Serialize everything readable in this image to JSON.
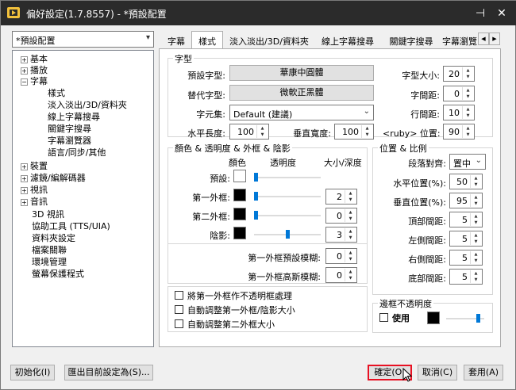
{
  "window": {
    "title": "偏好設定(1.7.8557) - *預設配置",
    "pin_glyph": "⊣",
    "close_glyph": "✕"
  },
  "profile": {
    "selected": "*預設配置"
  },
  "tree": {
    "items": [
      {
        "label": "基本",
        "exp": "+"
      },
      {
        "label": "播放",
        "exp": "+"
      },
      {
        "label": "字幕",
        "exp": "−"
      },
      {
        "label": "樣式"
      },
      {
        "label": "淡入淡出/3D/資料夾"
      },
      {
        "label": "線上字幕搜尋"
      },
      {
        "label": "關鍵字搜尋"
      },
      {
        "label": "字幕瀏覽器"
      },
      {
        "label": "語言/同步/其他"
      },
      {
        "label": "裝置",
        "exp": "+"
      },
      {
        "label": "濾鏡/編解碼器",
        "exp": "+"
      },
      {
        "label": "視訊",
        "exp": "+"
      },
      {
        "label": "音訊",
        "exp": "+"
      },
      {
        "label": "3D 視訊"
      },
      {
        "label": "協助工具 (TTS/UIA)"
      },
      {
        "label": "資料夾設定"
      },
      {
        "label": "檔案關聯"
      },
      {
        "label": "環境管理"
      },
      {
        "label": "螢幕保護程式"
      }
    ]
  },
  "tabs": [
    "字幕",
    "樣式",
    "淡入淡出/3D/資料夾",
    "線上字幕搜尋",
    "關鍵字搜尋",
    "字幕瀏覽"
  ],
  "font_group": {
    "title": "字型",
    "primary_label": "預設字型:",
    "primary_value": "華康中圓體",
    "alt_label": "替代字型:",
    "alt_value": "微軟正黑體",
    "charset_label": "字元集:",
    "charset_value": "Default (建議)",
    "hscale_label": "水平長度:",
    "hscale_value": "100",
    "vscale_label": "垂直寬度:",
    "vscale_value": "100",
    "size_label": "字型大小:",
    "size_value": "20",
    "spacing_label": "字間距:",
    "spacing_value": "0",
    "linespacing_label": "行間距:",
    "linespacing_value": "10",
    "ruby_label": "<ruby> 位置:",
    "ruby_value": "90"
  },
  "color_group": {
    "title": "顏色 & 透明度 & 外框 & 陰影",
    "col_color": "顏色",
    "col_opacity": "透明度",
    "col_size": "大小/深度",
    "rows": [
      {
        "label": "預設:",
        "color": "#ffffff",
        "opacity": 0,
        "size": null
      },
      {
        "label": "第一外框:",
        "color": "#000000",
        "opacity": 0,
        "size": "2"
      },
      {
        "label": "第二外框:",
        "color": "#000000",
        "opacity": 0,
        "size": "0"
      },
      {
        "label": "陰影:",
        "color": "#000000",
        "opacity": 0.5,
        "size": "3"
      }
    ],
    "blur1_label": "第一外框預設模糊:",
    "blur1_value": "0",
    "blur2_label": "第一外框高斯模糊:",
    "blur2_value": "0"
  },
  "checks": [
    {
      "label": "將第一外框作不透明框處理",
      "checked": false
    },
    {
      "label": "自動調整第一外框/陰影大小",
      "checked": false
    },
    {
      "label": "自動調整第二外框大小",
      "checked": false
    }
  ],
  "pos_group": {
    "title": "位置 & 比例",
    "align_label": "段落對齊:",
    "align_value": "置中",
    "hpos_label": "水平位置(%):",
    "hpos_value": "50",
    "vpos_label": "垂直位置(%):",
    "vpos_value": "95",
    "top_label": "頂部間距:",
    "top_value": "5",
    "left_label": "左側間距:",
    "left_value": "5",
    "right_label": "右側間距:",
    "right_value": "5",
    "bottom_label": "底部間距:",
    "bottom_value": "5"
  },
  "border_group": {
    "title": "邊框不透明度",
    "use_label": "使用",
    "color": "#000000",
    "opacity": 0.85
  },
  "footer": {
    "init_label": "初始化(I)",
    "export_label": "匯出目前設定為(S)...",
    "ok_label": "確定(O)",
    "cancel_label": "取消(C)",
    "apply_label": "套用(A)"
  },
  "colors": {
    "accent": "#0078d7",
    "highlight": "#e81123"
  }
}
